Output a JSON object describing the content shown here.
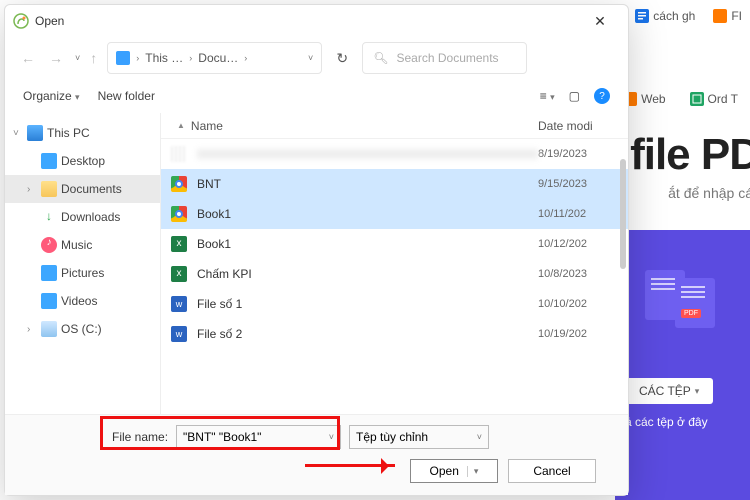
{
  "bg": {
    "tabs": [
      {
        "label": "cách gh",
        "icon": "docs-icon",
        "color": "#1a73e8"
      },
      {
        "label": "FI",
        "icon": "fpt-icon",
        "color": "#ff7a00"
      }
    ],
    "row2": [
      {
        "label": "Web",
        "icon": "fpt-icon",
        "color": "#ff7a00"
      },
      {
        "label": "Ord T",
        "icon": "sheets-icon",
        "color": "#1fa463"
      }
    ],
    "title": "file PD",
    "subtitle": "ắt để nhập các",
    "panel_button": "CÁC TỆP",
    "panel_sub": "ả các tệp ở đây"
  },
  "dialog": {
    "title": "Open",
    "breadcrumb": {
      "root": "This …",
      "folder": "Docu…"
    },
    "search_placeholder": "Search Documents",
    "toolbar": {
      "organize": "Organize",
      "new_folder": "New folder"
    },
    "columns": {
      "name": "Name",
      "date": "Date modi"
    },
    "tree": [
      {
        "label": "This PC",
        "icon": "ic-pc",
        "expanded": true
      },
      {
        "label": "Desktop",
        "icon": "ic-desktop"
      },
      {
        "label": "Documents",
        "icon": "ic-folder",
        "selected": true
      },
      {
        "label": "Downloads",
        "icon": "ic-down"
      },
      {
        "label": "Music",
        "icon": "ic-music"
      },
      {
        "label": "Pictures",
        "icon": "ic-pic"
      },
      {
        "label": "Videos",
        "icon": "ic-vid"
      },
      {
        "label": "OS (C:)",
        "icon": "ic-disk"
      }
    ],
    "files": [
      {
        "name": "",
        "date": "8/19/2023",
        "icon": "fic-blank",
        "blurred": true
      },
      {
        "name": "BNT",
        "date": "9/15/2023",
        "icon": "fic-chrome",
        "selected": true
      },
      {
        "name": "Book1",
        "date": "10/11/202",
        "icon": "fic-chrome",
        "selected": true
      },
      {
        "name": "Book1",
        "date": "10/12/202",
        "icon": "fic-xls"
      },
      {
        "name": "Chấm KPI",
        "date": "10/8/2023",
        "icon": "fic-xls"
      },
      {
        "name": "File số 1",
        "date": "10/10/202",
        "icon": "fic-doc"
      },
      {
        "name": "File số 2",
        "date": "10/19/202",
        "icon": "fic-doc"
      }
    ],
    "footer": {
      "filename_label": "File name:",
      "filename_value": "\"BNT\" \"Book1\"",
      "filter_label": "Tệp tùy chỉnh",
      "open_label": "Open",
      "cancel_label": "Cancel"
    }
  }
}
